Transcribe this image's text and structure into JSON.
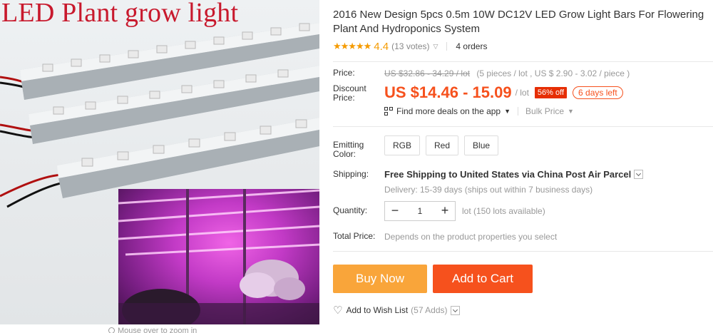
{
  "gallery": {
    "promo_title": "LED Plant grow light",
    "zoom_hint": "Mouse over to zoom in"
  },
  "product": {
    "title": "2016 New Design 5pcs 0.5m 10W DC12V LED Grow Light Bars For Flowering Plant And Hydroponics System",
    "rating": {
      "stars_value": 4.4,
      "stars": "★★★★★",
      "score": "4.4",
      "votes": "(13 votes)",
      "orders": "4 orders"
    }
  },
  "price": {
    "label": "Price:",
    "original": "US $32.86 - 34.29 / lot",
    "detail": "(5 pieces / lot , US $ 2.90 - 3.02 / piece )",
    "discount_label_1": "Discount",
    "discount_label_2": "Price:",
    "current": "US $14.46 - 15.09",
    "unit": "/ lot",
    "discount_badge": "56% off",
    "time_left": "6 days left"
  },
  "deals": {
    "app_text": "Find more deals on the app",
    "bulk_text": "Bulk Price"
  },
  "emitting": {
    "label_1": "Emitting",
    "label_2": "Color:",
    "options": [
      "RGB",
      "Red",
      "Blue"
    ]
  },
  "shipping": {
    "label": "Shipping:",
    "text": "Free Shipping to United States via China Post Air Parcel",
    "delivery": "Delivery: 15-39 days (ships out within 7 business days)"
  },
  "quantity": {
    "label": "Quantity:",
    "minus": "−",
    "value": "1",
    "plus": "+",
    "available": "lot (150 lots available)"
  },
  "total": {
    "label": "Total Price:",
    "text": "Depends on the product properties you select"
  },
  "actions": {
    "buy_now": "Buy Now",
    "add_to_cart": "Add to Cart",
    "wish_list": "Add to Wish List",
    "wish_count": "(57 Adds)"
  },
  "colors": {
    "price_accent": "#f6511d",
    "buy_now_bg": "#f9a53a",
    "add_to_cart_bg": "#f6511d",
    "discount_badge_bg": "#e62e04",
    "star_color": "#f59b00",
    "promo_title_color": "#c8192d"
  },
  "icons": [
    "qr-code-icon",
    "chevron-down-icon",
    "heart-icon",
    "magnifier-icon"
  ]
}
